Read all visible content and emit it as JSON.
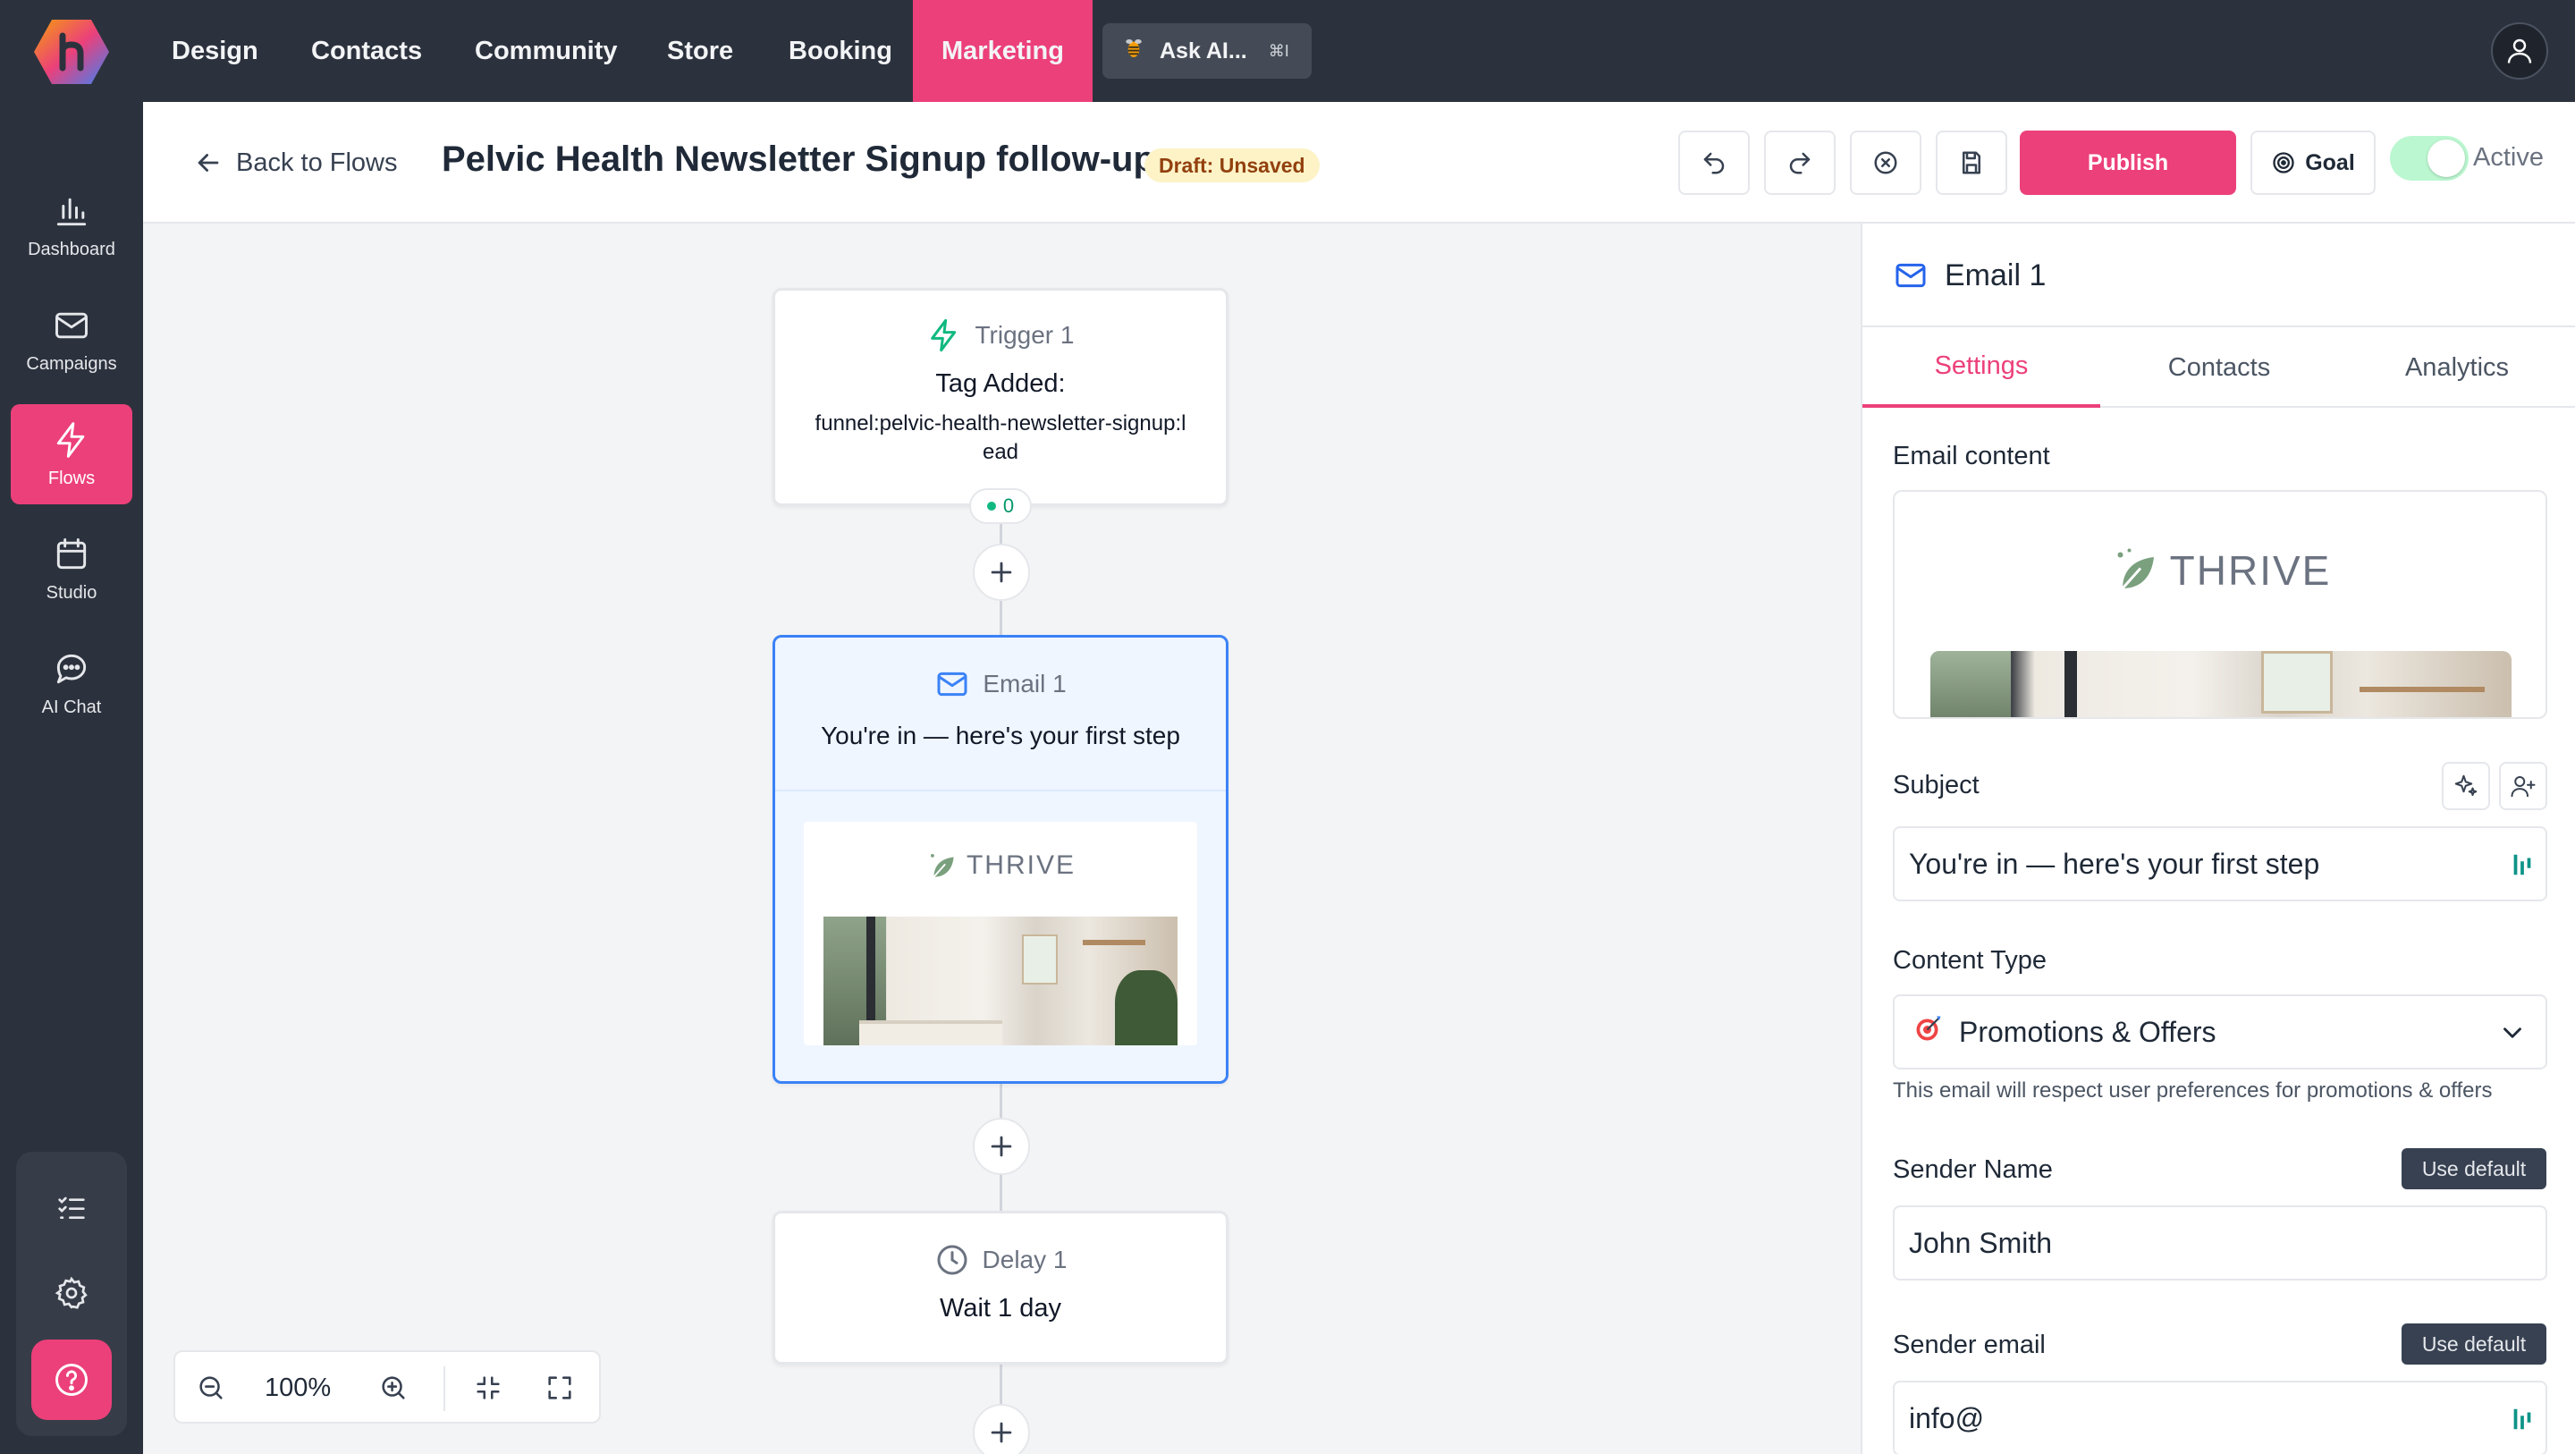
{
  "nav": {
    "items": [
      "Design",
      "Contacts",
      "Community",
      "Store",
      "Booking",
      "Marketing"
    ],
    "active": "Marketing",
    "ask_ai": "Ask AI...",
    "ask_ai_shortcut": "⌘I"
  },
  "sidebar": {
    "items": [
      {
        "label": "Dashboard",
        "icon": "bar-chart-icon"
      },
      {
        "label": "Campaigns",
        "icon": "mail-icon"
      },
      {
        "label": "Flows",
        "icon": "bolt-icon"
      },
      {
        "label": "Studio",
        "icon": "calendar-icon"
      },
      {
        "label": "AI Chat",
        "icon": "chat-icon"
      }
    ],
    "active": "Flows"
  },
  "header": {
    "back_label": "Back to Flows",
    "title": "Pelvic Health Newsletter Signup follow-up",
    "status_badge": "Draft: Unsaved",
    "publish_label": "Publish",
    "goal_label": "Goal",
    "active_label": "Active",
    "active_toggle_on": true
  },
  "canvas": {
    "zoom": "100%",
    "nodes": {
      "trigger": {
        "title": "Trigger 1",
        "line1": "Tag Added:",
        "line2": "funnel:pelvic-health-newsletter-signup:lead",
        "count": "0"
      },
      "email": {
        "title": "Email 1",
        "subject": "You're in — here's your first step",
        "brand": "THRIVE"
      },
      "delay": {
        "title": "Delay 1",
        "body": "Wait 1 day"
      }
    }
  },
  "panel": {
    "title": "Email 1",
    "tabs": [
      "Settings",
      "Contacts",
      "Analytics"
    ],
    "active_tab": "Settings",
    "email_content_label": "Email content",
    "brand": "THRIVE",
    "subject_label": "Subject",
    "subject_value": "You're in — here's your first step",
    "content_type_label": "Content Type",
    "content_type_value": "Promotions & Offers",
    "content_type_note": "This email will respect user preferences for promotions & offers",
    "sender_name_label": "Sender Name",
    "sender_name_value": "John Smith",
    "sender_email_label": "Sender email",
    "sender_email_value": "info@",
    "use_default_label": "Use default"
  },
  "colors": {
    "brand_pink": "#ec407a",
    "nav_bg": "#2c323d",
    "selected_blue": "#3b82f6",
    "accent_green": "#10b981"
  }
}
